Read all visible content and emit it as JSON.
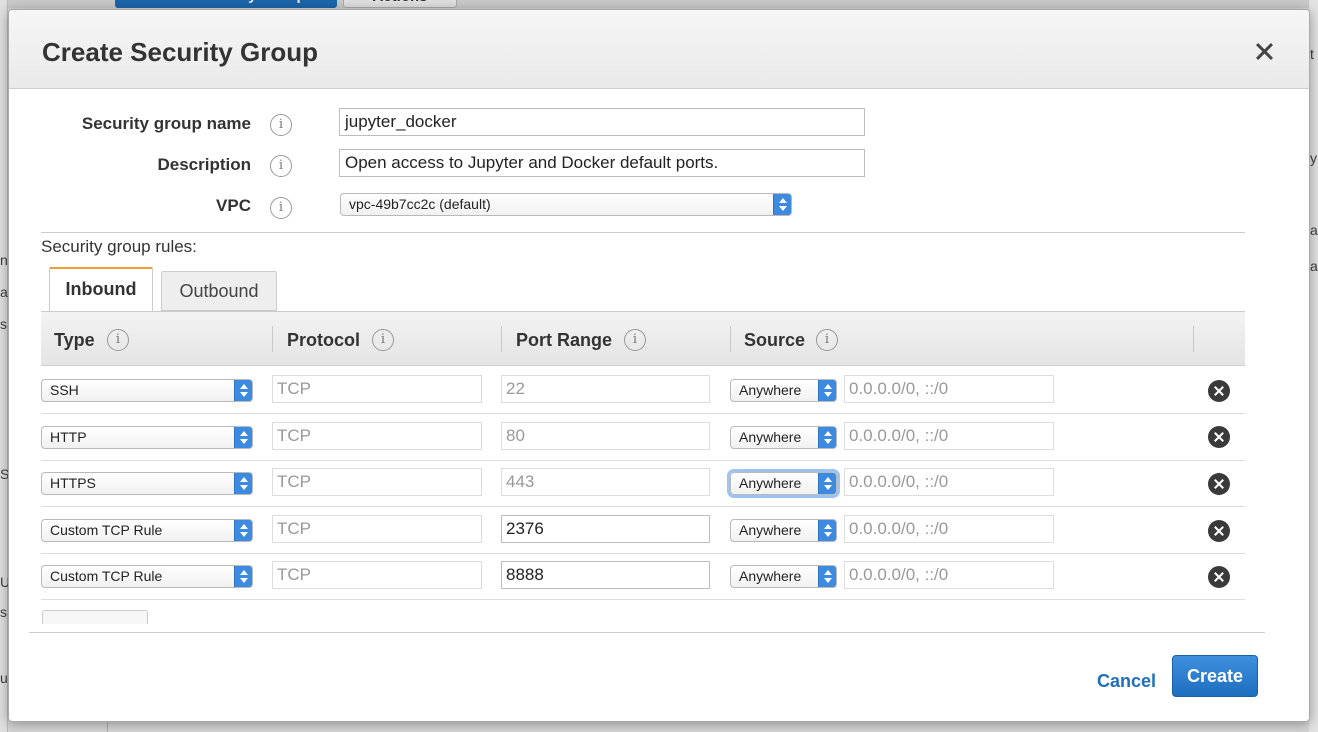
{
  "background": {
    "primary_button": "Create Security Group",
    "actions_button": "Actions",
    "left_fragments": [
      "n",
      "a",
      "s",
      "S",
      "U",
      "s",
      "u"
    ],
    "right_fragments": [
      "t",
      "y",
      "a",
      "a"
    ]
  },
  "modal": {
    "title": "Create Security Group",
    "close_label": "×",
    "fields": {
      "name_label": "Security group name",
      "name_value": "jupyter_docker",
      "description_label": "Description",
      "description_value": "Open access to Jupyter and Docker default ports.",
      "vpc_label": "VPC",
      "vpc_value": "vpc-49b7cc2c (default)"
    },
    "info_glyph": "i",
    "rules_label": "Security group rules:",
    "tabs": {
      "inbound": "Inbound",
      "outbound": "Outbound"
    },
    "columns": {
      "type": "Type",
      "protocol": "Protocol",
      "port_range": "Port Range",
      "source": "Source"
    },
    "rules": [
      {
        "type": "SSH",
        "protocol": "TCP",
        "port": "22",
        "source": "Anywhere",
        "cidr": "0.0.0.0/0, ::/0",
        "editable_port": false
      },
      {
        "type": "HTTP",
        "protocol": "TCP",
        "port": "80",
        "source": "Anywhere",
        "cidr": "0.0.0.0/0, ::/0",
        "editable_port": false
      },
      {
        "type": "HTTPS",
        "protocol": "TCP",
        "port": "443",
        "source": "Anywhere",
        "cidr": "0.0.0.0/0, ::/0",
        "editable_port": false,
        "source_focused": true
      },
      {
        "type": "Custom TCP Rule",
        "protocol": "TCP",
        "port": "2376",
        "source": "Anywhere",
        "cidr": "0.0.0.0/0, ::/0",
        "editable_port": true
      },
      {
        "type": "Custom TCP Rule",
        "protocol": "TCP",
        "port": "8888",
        "source": "Anywhere",
        "cidr": "0.0.0.0/0, ::/0",
        "editable_port": true
      }
    ],
    "footer": {
      "cancel": "Cancel",
      "create": "Create"
    }
  },
  "colors": {
    "accent": "#1f6fb9",
    "tab_active_border": "#f0a030",
    "select_arrow": "#3d8be0"
  }
}
